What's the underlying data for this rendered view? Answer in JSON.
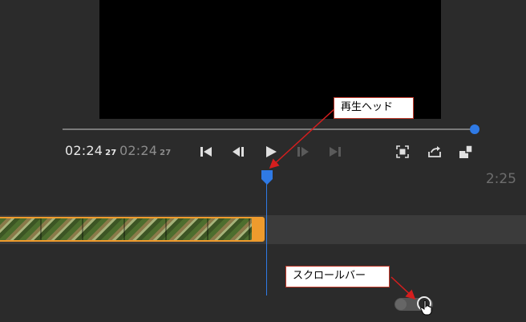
{
  "player": {
    "current_time": "02:24",
    "current_frames": "27",
    "total_time": "02:24",
    "total_frames": "27",
    "accent_color": "#2f7ae5"
  },
  "controls": {
    "left": [
      "skip-to-start-icon",
      "previous-frame-icon",
      "play-icon",
      "next-frame-icon",
      "skip-to-end-icon"
    ],
    "right": [
      "fit-screen-icon",
      "share-icon",
      "layout-icon"
    ]
  },
  "timeline": {
    "timecode": "2:25",
    "clip_color": "#ee9b2d"
  },
  "annotations": {
    "playhead": "再生ヘッド",
    "scrollbar": "スクロールバー",
    "arrow_color": "#d51e1e"
  }
}
